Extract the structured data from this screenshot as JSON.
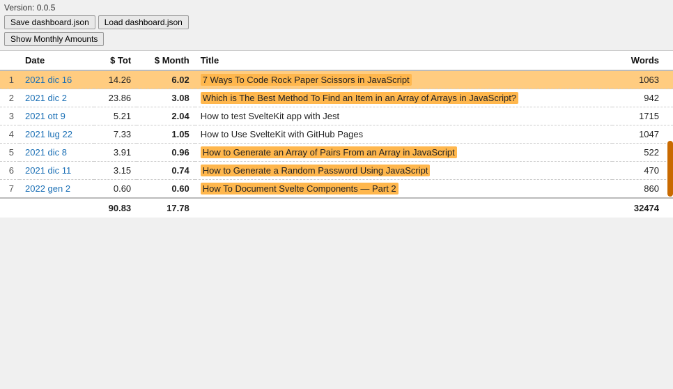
{
  "app": {
    "version": "Version: 0.0.5"
  },
  "toolbar": {
    "save_label": "Save dashboard.json",
    "load_label": "Load dashboard.json",
    "toggle_label": "Show Monthly Amounts"
  },
  "table": {
    "columns": [
      "",
      "Date",
      "$ Tot",
      "$ Month",
      "Title",
      "Words"
    ],
    "rows": [
      {
        "idx": 1,
        "date": "2021 dic 16",
        "tot": "14.26",
        "month": "6.02",
        "title": "7 Ways To Code Rock Paper Scissors in JavaScript",
        "title_highlighted": true,
        "words": "1063"
      },
      {
        "idx": 2,
        "date": "2021 dic 2",
        "tot": "23.86",
        "month": "3.08",
        "title": "Which is The Best Method To Find an Item in an Array of Arrays in JavaScript?",
        "title_highlighted": true,
        "words": "942"
      },
      {
        "idx": 3,
        "date": "2021 ott 9",
        "tot": "5.21",
        "month": "2.04",
        "title": "How to test SvelteKit app with Jest",
        "title_highlighted": false,
        "words": "1715"
      },
      {
        "idx": 4,
        "date": "2021 lug 22",
        "tot": "7.33",
        "month": "1.05",
        "title": "How to Use SvelteKit with GitHub Pages",
        "title_highlighted": false,
        "words": "1047"
      },
      {
        "idx": 5,
        "date": "2021 dic 8",
        "tot": "3.91",
        "month": "0.96",
        "title": "How to Generate an Array of Pairs From an Array in JavaScript",
        "title_highlighted": true,
        "words": "522"
      },
      {
        "idx": 6,
        "date": "2021 dic 11",
        "tot": "3.15",
        "month": "0.74",
        "title": "How to Generate a Random Password Using JavaScript",
        "title_highlighted": true,
        "words": "470"
      },
      {
        "idx": 7,
        "date": "2022 gen 2",
        "tot": "0.60",
        "month": "0.60",
        "title": "How To Document Svelte Components — Part 2",
        "title_highlighted": true,
        "words": "860"
      }
    ],
    "footer": {
      "tot": "90.83",
      "month": "17.78",
      "words": "32474"
    }
  }
}
